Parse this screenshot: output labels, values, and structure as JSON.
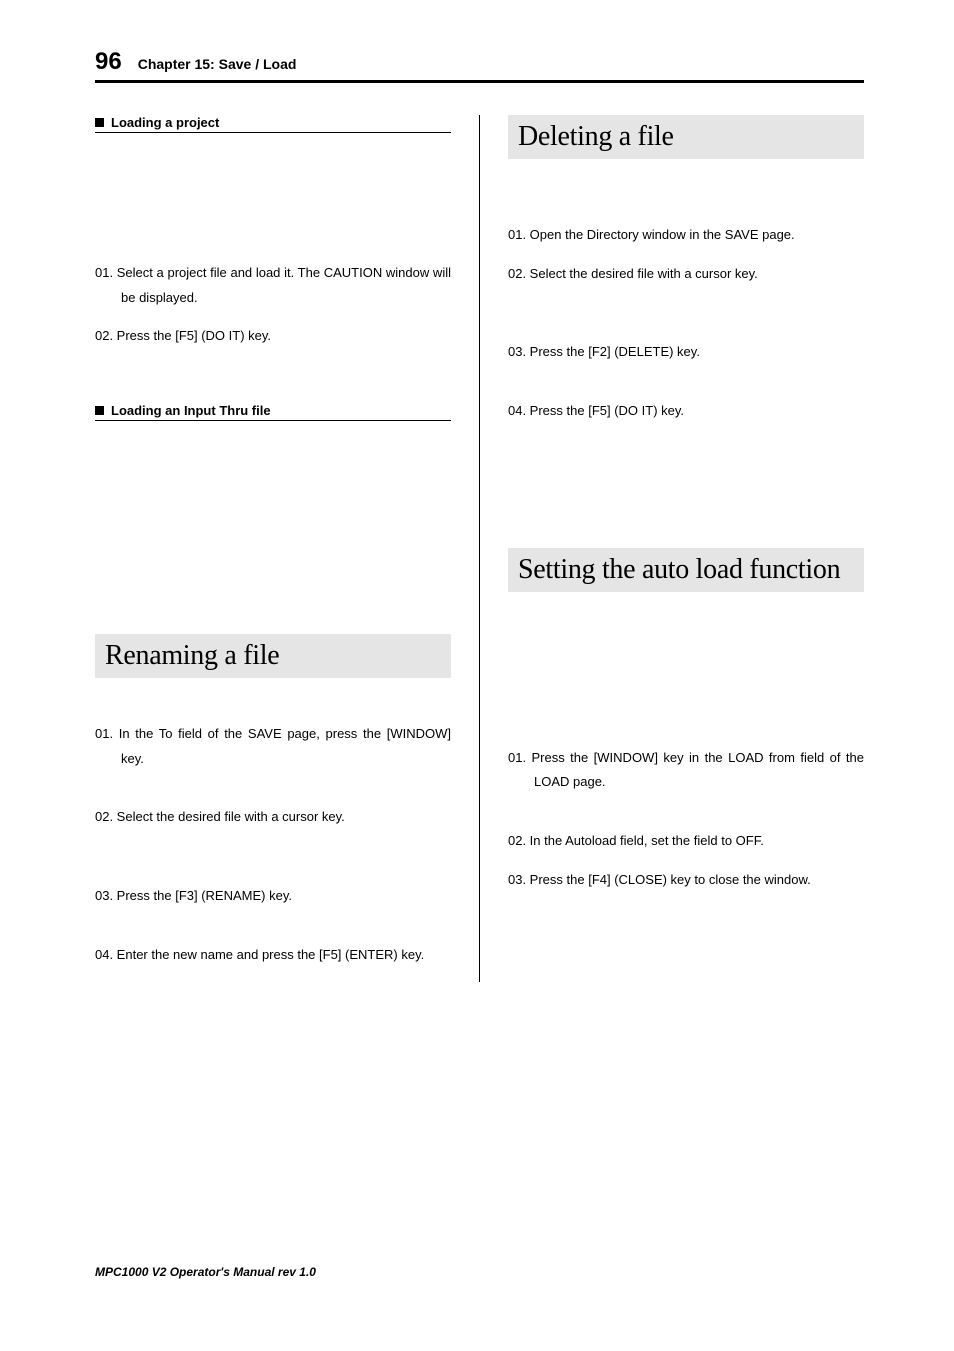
{
  "header": {
    "page_number": "96",
    "chapter": "Chapter 15: Save / Load"
  },
  "left": {
    "sub1": {
      "title": "Loading a project",
      "steps": [
        "01. Select a project file and load it. The CAUTION window will be displayed.",
        "02. Press the [F5] (DO IT) key."
      ]
    },
    "sub2": {
      "title": "Loading an Input Thru file"
    },
    "section1": {
      "heading": "Renaming a file",
      "steps": [
        "01. In the To field of the SAVE page, press the [WINDOW] key.",
        "02. Select the desired file with a cursor key.",
        "03. Press the [F3] (RENAME) key.",
        "04. Enter the new name and press the [F5] (ENTER) key."
      ]
    }
  },
  "right": {
    "section1": {
      "heading": "Deleting a file",
      "steps": [
        "01. Open the Directory window in the SAVE page.",
        "02. Select the desired file with a cursor key.",
        "03. Press the [F2] (DELETE) key.",
        "04. Press the [F5] (DO IT) key."
      ]
    },
    "section2": {
      "heading": "Setting the auto load function",
      "steps": [
        "01. Press the [WINDOW] key in the LOAD from field of the LOAD page.",
        "02. In the Autoload field, set the field to OFF.",
        "03. Press the [F4] (CLOSE) key to close the window."
      ]
    }
  },
  "footer": "MPC1000 V2 Operator's Manual rev 1.0"
}
